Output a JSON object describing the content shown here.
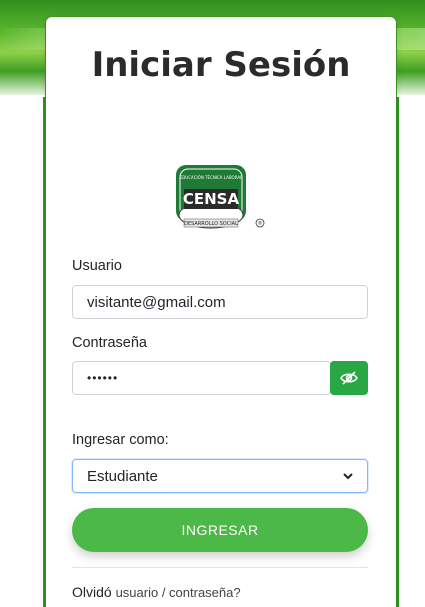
{
  "login": {
    "title": "Iniciar Sesión",
    "logo": {
      "top_text": "EDUCACIÓN TÉCNICA LABORAL",
      "name": "CENSA",
      "bottom_text": "DESARROLLO SOCIAL",
      "mark": "®"
    },
    "username_label": "Usuario",
    "username_value": "visitante@gmail.com",
    "password_label": "Contraseña",
    "password_value": "••••••",
    "role_label": "Ingresar como:",
    "role_selected": "Estudiante",
    "submit_label": "INGRESAR",
    "forgot_prefix": "Olvidó ",
    "forgot_link": "usuario / contraseña?"
  },
  "colors": {
    "accent_green": "#4cb848",
    "eye_button": "#28a745",
    "brand_green": "#2f8f1f"
  },
  "icons": {
    "password_toggle": "eye-slash-icon",
    "select_arrow": "chevron-down-icon"
  }
}
